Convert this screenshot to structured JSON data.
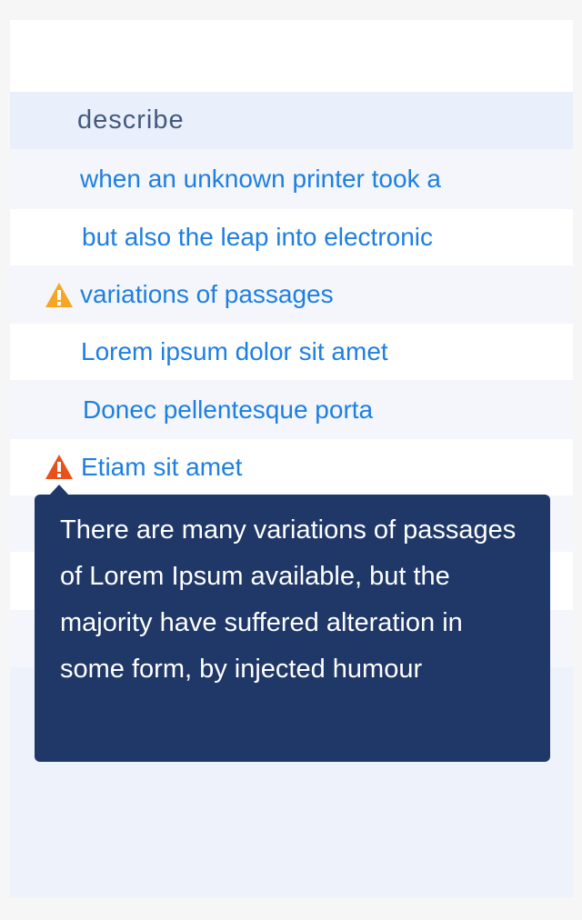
{
  "list": {
    "header": "describe",
    "items": [
      {
        "label": "when an unknown printer took a",
        "warning": null
      },
      {
        "label": "but also the leap into electronic",
        "warning": null
      },
      {
        "label": "variations of passages",
        "warning": "warning-yellow"
      },
      {
        "label": "Lorem ipsum dolor sit amet",
        "warning": null
      },
      {
        "label": "Donec pellentesque porta",
        "warning": null
      },
      {
        "label": "Etiam sit amet",
        "warning": "warning-red"
      }
    ]
  },
  "tooltip": {
    "text": "There are many variations of passages of Lorem Ipsum available, but the majority have suffered alteration in some form, by injected humour"
  },
  "colors": {
    "link": "#1e7fe0",
    "header": "#44597f",
    "tooltip_bg": "#1f3868",
    "warning_yellow": "#f5a623",
    "warning_red": "#e8521a"
  }
}
